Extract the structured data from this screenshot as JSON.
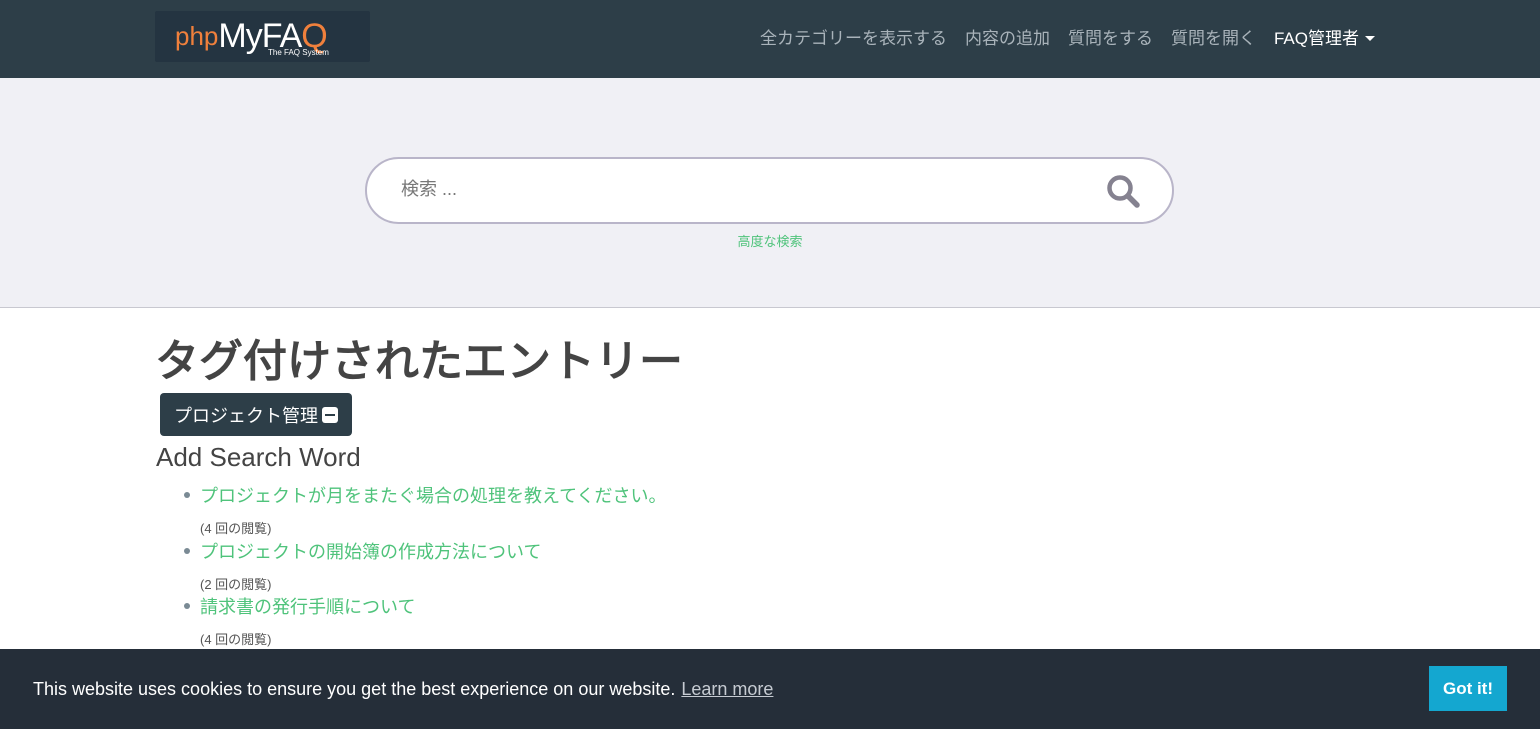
{
  "header": {
    "logo_text": "phpMyFAQ",
    "logo_sub": "The FAQ System",
    "menu": [
      "全カテゴリーを表示する",
      "内容の追加",
      "質問をする",
      "質問を開く"
    ],
    "admin_label": "FAQ管理者"
  },
  "search": {
    "placeholder": "検索 ...",
    "advanced": "高度な検索"
  },
  "main": {
    "title": "タグ付けされたエントリー",
    "tag": "プロジェクト管理",
    "subtitle": "Add Search Word",
    "entries": [
      {
        "title": "プロジェクトが月をまたぐ場合の処理を教えてください。",
        "views": "(4 回の閲覧)"
      },
      {
        "title": "プロジェクトの開始簿の作成方法について",
        "views": "(2 回の閲覧)"
      },
      {
        "title": "請求書の発行手順について",
        "views": "(4 回の閲覧)"
      }
    ]
  },
  "cookie": {
    "message": "This website uses cookies to ensure you get the best experience on our website.",
    "learn": "Learn more",
    "button": "Got it!"
  },
  "colors": {
    "nav": "#2d3e48",
    "accent": "#4fc37b",
    "cookie_button": "#14a7d0"
  }
}
